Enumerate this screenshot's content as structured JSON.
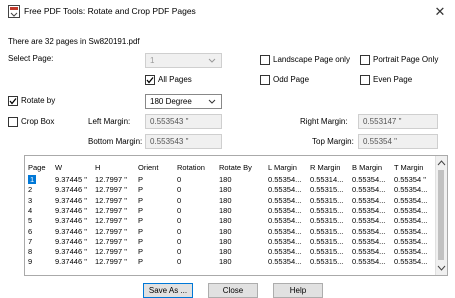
{
  "window": {
    "title": "Free PDF Tools: Rotate and Crop PDF Pages",
    "close_glyph": "✕"
  },
  "info": {
    "pages_text": "There are 32 pages in Sw820191.pdf"
  },
  "select_page": {
    "label": "Select Page:",
    "value": "1",
    "all_pages_label": "All Pages",
    "all_pages_checked": true,
    "landscape_label": "Landscape Page only",
    "portrait_label": "Portrait Page Only",
    "odd_label": "Odd Page",
    "even_label": "Even Page"
  },
  "rotate": {
    "label": "Rotate by",
    "checked": true,
    "value": "180 Degree"
  },
  "crop": {
    "label": "Crop Box",
    "checked": false,
    "left_label": "Left Margin:",
    "left_value": "0.553543 \"",
    "right_label": "Right Margin:",
    "right_value": "0.553147 \"",
    "bottom_label": "Bottom Margin:",
    "bottom_value": "0.553543 \"",
    "top_label": "Top Margin:",
    "top_value": "0.55354 \""
  },
  "table": {
    "headers": [
      "Page",
      "W",
      "H",
      "Orient",
      "Rotation",
      "Rotate By",
      "L Margin",
      "R Margin",
      "B Margin",
      "T Margin"
    ],
    "rows": [
      [
        "1",
        "9.37445 \"",
        "12.7997 \"",
        "P",
        "0",
        "180",
        "0.55354...",
        "0.55314...",
        "0.55354...",
        "0.55354 \""
      ],
      [
        "2",
        "9.37446 \"",
        "12.7997 \"",
        "P",
        "0",
        "180",
        "0.55354...",
        "0.55315...",
        "0.55354...",
        "0.55354..."
      ],
      [
        "3",
        "9.37446 \"",
        "12.7997 \"",
        "P",
        "0",
        "180",
        "0.55354...",
        "0.55315...",
        "0.55354...",
        "0.55354..."
      ],
      [
        "4",
        "9.37446 \"",
        "12.7997 \"",
        "P",
        "0",
        "180",
        "0.55354...",
        "0.55315...",
        "0.55354...",
        "0.55354..."
      ],
      [
        "5",
        "9.37446 \"",
        "12.7997 \"",
        "P",
        "0",
        "180",
        "0.55354...",
        "0.55315...",
        "0.55354...",
        "0.55354..."
      ],
      [
        "6",
        "9.37446 \"",
        "12.7997 \"",
        "P",
        "0",
        "180",
        "0.55354...",
        "0.55315...",
        "0.55354...",
        "0.55354..."
      ],
      [
        "7",
        "9.37446 \"",
        "12.7997 \"",
        "P",
        "0",
        "180",
        "0.55354...",
        "0.55315...",
        "0.55354...",
        "0.55354..."
      ],
      [
        "8",
        "9.37446 \"",
        "12.7997 \"",
        "P",
        "0",
        "180",
        "0.55354...",
        "0.55315...",
        "0.55354...",
        "0.55354..."
      ],
      [
        "9",
        "9.37446 \"",
        "12.7997 \"",
        "P",
        "0",
        "180",
        "0.55354...",
        "0.55315...",
        "0.55354...",
        "0.55354..."
      ]
    ],
    "selected_row": 0
  },
  "buttons": {
    "save_as": "Save As ...",
    "close": "Close",
    "help": "Help"
  },
  "colors": {
    "accent": "#0078d7",
    "field_bg": "#f0f0f0"
  }
}
